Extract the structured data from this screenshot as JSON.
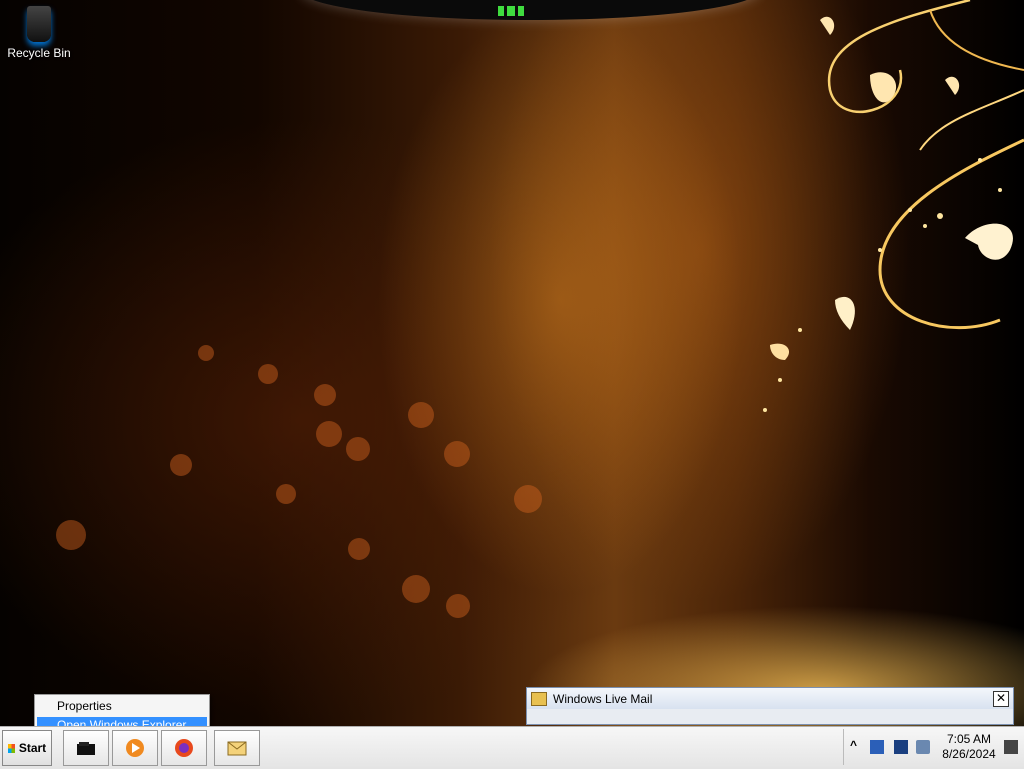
{
  "desktop": {
    "icons": [
      {
        "label": "Recycle Bin",
        "icon": "recycle-bin-icon"
      }
    ]
  },
  "notification": {
    "title": "Windows Live Mail",
    "icon": "mail-icon",
    "close_glyph": "✕"
  },
  "context_menu": {
    "items": [
      {
        "label": "Properties",
        "selected": false
      },
      {
        "label": "Open Windows Explorer",
        "selected": true
      }
    ]
  },
  "taskbar": {
    "start_label": "Start",
    "pinned": [
      {
        "icon": "windows-explorer-icon"
      },
      {
        "icon": "media-player-icon"
      },
      {
        "icon": "firefox-icon"
      },
      {
        "icon": "windows-live-mail-icon"
      }
    ],
    "tray": {
      "expand_glyph": "^",
      "time": "7:05 AM",
      "date": "8/26/2024"
    }
  }
}
